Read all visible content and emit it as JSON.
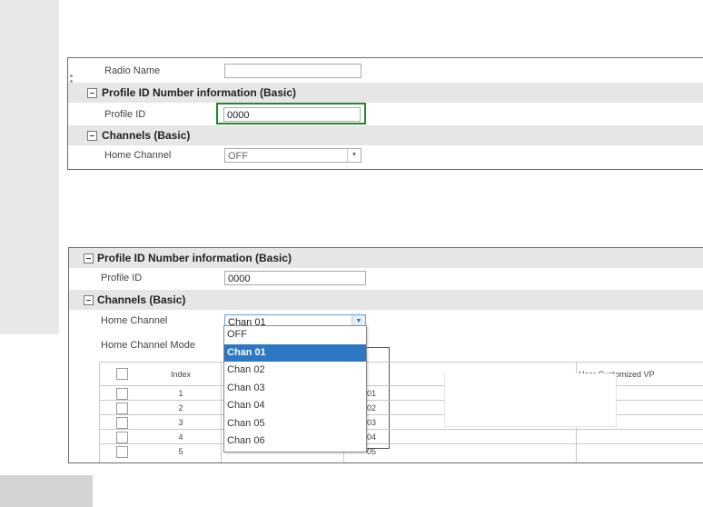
{
  "top_panel": {
    "radio_name_label": "Radio Name",
    "radio_name_value": "",
    "section_profile": "Profile ID Number information (Basic)",
    "profile_id_label": "Profile ID",
    "profile_id_value": "0000",
    "section_channels": "Channels (Basic)",
    "home_channel_label": "Home Channel",
    "home_channel_value": "OFF"
  },
  "bottom_panel": {
    "section_profile": "Profile ID Number information (Basic)",
    "profile_id_label": "Profile ID",
    "profile_id_value": "0000",
    "section_channels": "Channels (Basic)",
    "home_channel_label": "Home Channel",
    "home_channel_value": "Chan 01",
    "home_channel_mode_label": "Home Channel Mode",
    "table": {
      "headers": [
        "Index",
        "User Customized VP"
      ],
      "index_values": [
        "1",
        "2",
        "3",
        "4",
        "5"
      ],
      "partial_values": [
        "01",
        "02",
        "03",
        "04",
        "05"
      ]
    },
    "dropdown_options": [
      "OFF",
      "Chan 01",
      "Chan 02",
      "Chan 03",
      "Chan 04",
      "Chan 05",
      "Chan 06"
    ],
    "dropdown_selected": "Chan 01"
  },
  "colors": {
    "highlight_border": "#1e8a2a",
    "selection_blue": "#2d78c2",
    "section_bg": "#e6e6e6"
  }
}
